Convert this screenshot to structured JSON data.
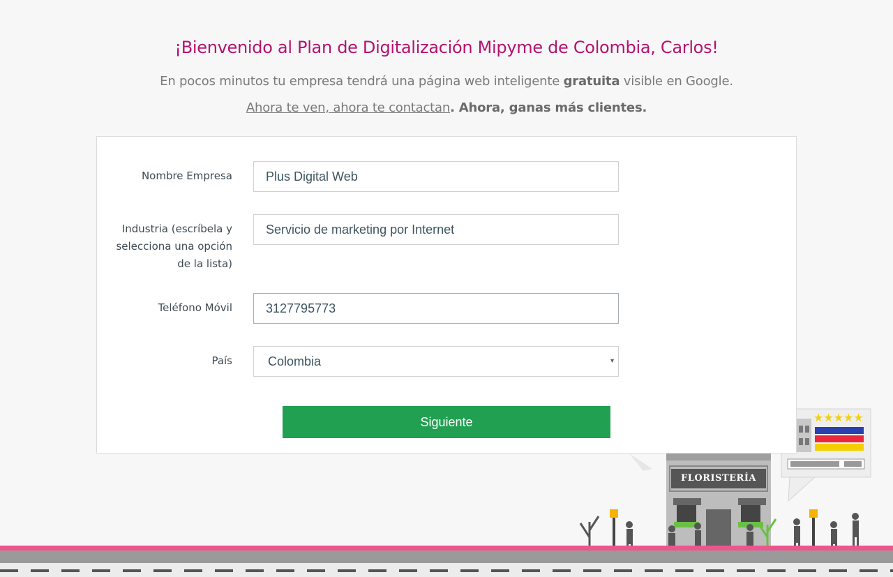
{
  "header": {
    "title": "¡Bienvenido al Plan de Digitalización Mipyme de Colombia, Carlos!",
    "subtitle_pre": "En pocos minutos tu empresa tendrá una página web inteligente ",
    "subtitle_bold": "gratuita",
    "subtitle_post": " visible en Google.",
    "tagline_link": "Ahora te ven, ahora te contactan",
    "tagline_bold": ". Ahora, ganas más clientes."
  },
  "form": {
    "company": {
      "label": "Nombre Empresa",
      "value": "Plus Digital Web"
    },
    "industry": {
      "label": "Industria (escríbela y selecciona una opción de la lista)",
      "value": "Servicio de marketing por Internet"
    },
    "phone": {
      "label": "Teléfono Móvil",
      "value": "3127795773"
    },
    "country": {
      "label": "País",
      "value": "Colombia",
      "caret": "▾"
    },
    "submit_label": "Siguiente"
  },
  "illustration": {
    "shop_sign": "FLORISTERÍA",
    "stars": "★★★★★"
  },
  "colors": {
    "accent": "#b4136f",
    "button": "#22a052",
    "flag_yellow": "#f5d000",
    "flag_blue": "#2a3fb0",
    "flag_red": "#e8283e"
  }
}
